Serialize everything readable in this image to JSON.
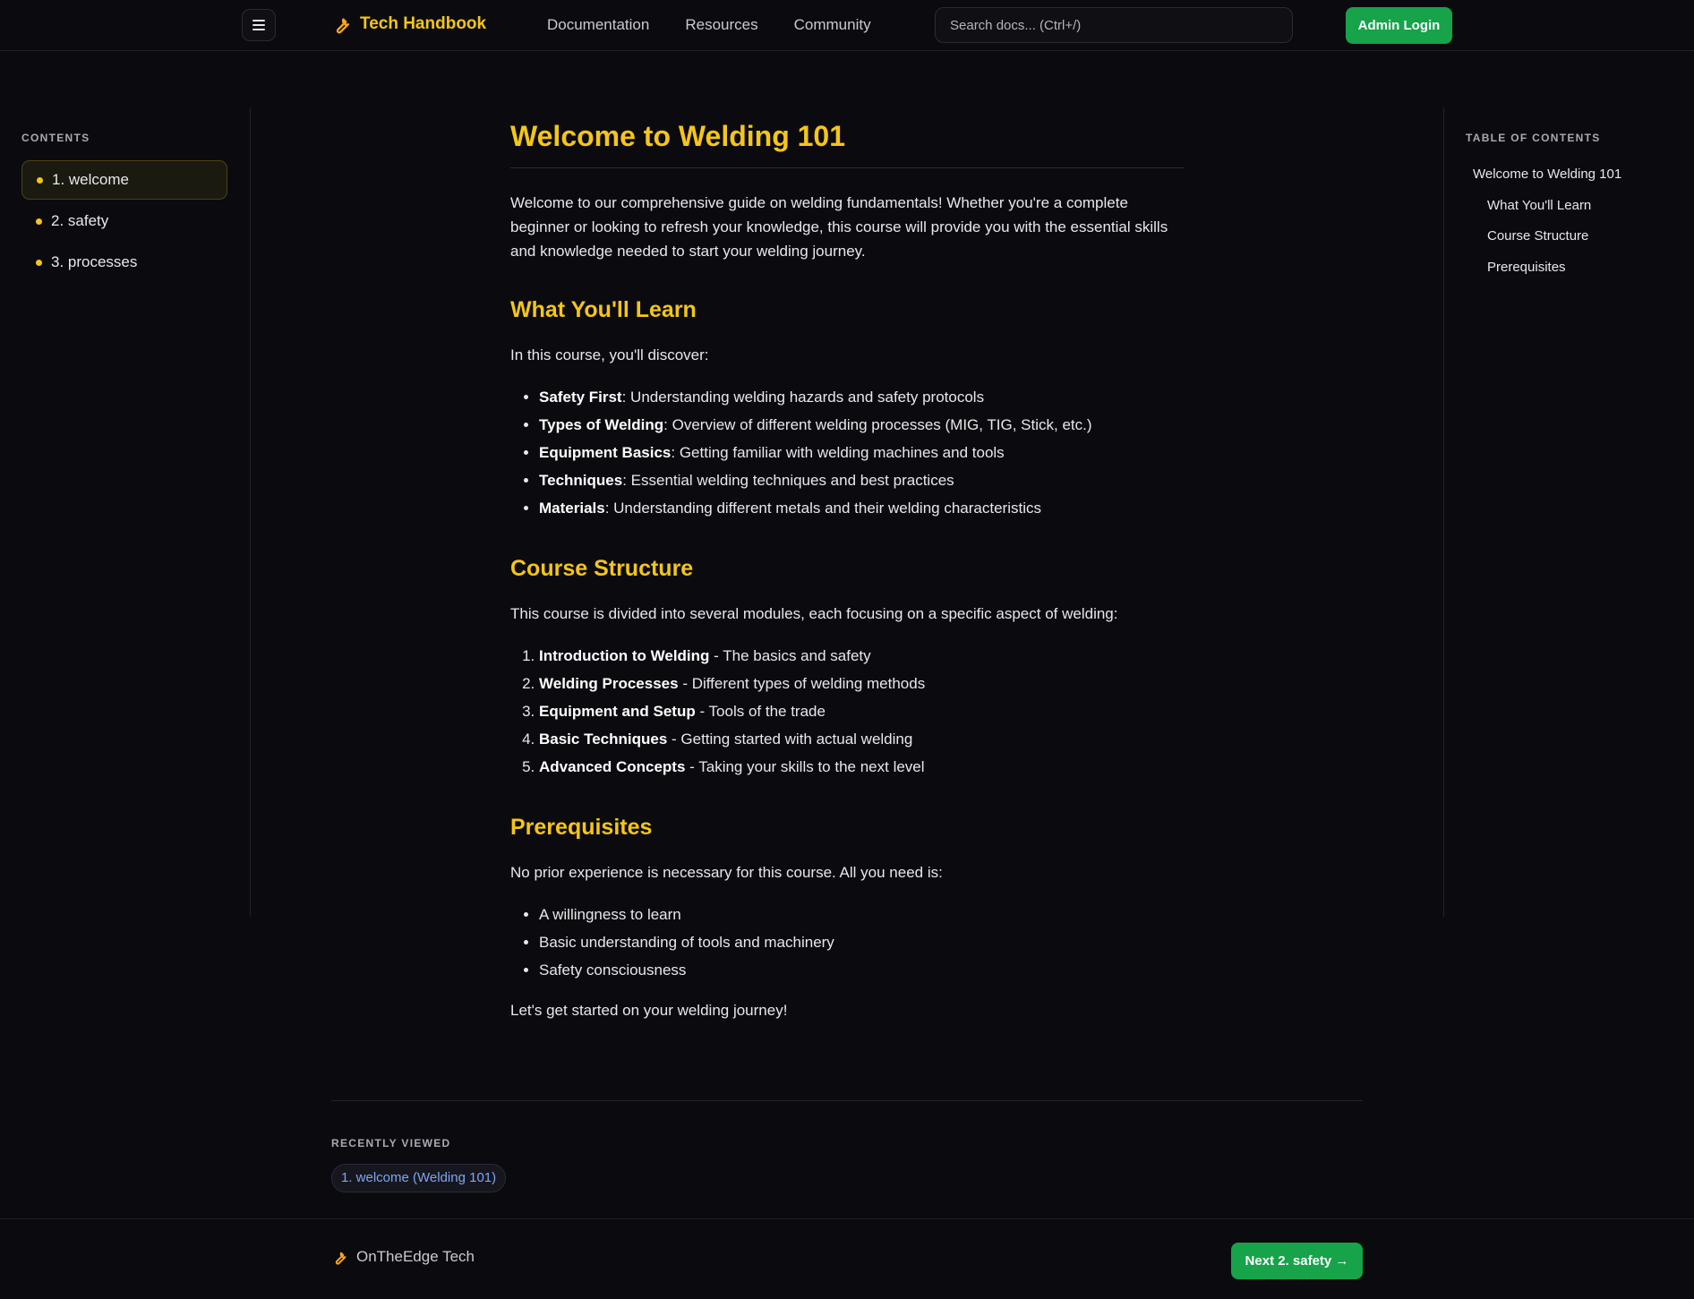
{
  "header": {
    "menu_icon": "hamburger-menu-icon",
    "brand_icon": "wrench-icon",
    "brand": "Tech Handbook",
    "nav": [
      "Documentation",
      "Resources",
      "Community"
    ],
    "search_placeholder": "Search docs... (Ctrl+/)",
    "admin_button": "Admin Login"
  },
  "left_sidebar": {
    "heading": "CONTENTS",
    "items": [
      {
        "label": "1. welcome",
        "active": true
      },
      {
        "label": "2. safety",
        "active": false
      },
      {
        "label": "3. processes",
        "active": false
      }
    ]
  },
  "right_sidebar": {
    "heading": "TABLE OF CONTENTS",
    "items": [
      {
        "label": "Welcome to Welding 101",
        "level": 1
      },
      {
        "label": "What You'll Learn",
        "level": 2
      },
      {
        "label": "Course Structure",
        "level": 2
      },
      {
        "label": "Prerequisites",
        "level": 2
      }
    ]
  },
  "article": {
    "title": "Welcome to Welding 101",
    "intro": "Welcome to our comprehensive guide on welding fundamentals! Whether you're a complete beginner or looking to refresh your knowledge, this course will provide you with the essential skills and knowledge needed to start your welding journey.",
    "learn": {
      "heading": "What You'll Learn",
      "lead": "In this course, you'll discover:",
      "items": [
        {
          "term": "Safety First",
          "sep": ": ",
          "desc": "Understanding welding hazards and safety protocols"
        },
        {
          "term": "Types of Welding",
          "sep": ": ",
          "desc": "Overview of different welding processes (MIG, TIG, Stick, etc.)"
        },
        {
          "term": "Equipment Basics",
          "sep": ": ",
          "desc": "Getting familiar with welding machines and tools"
        },
        {
          "term": "Techniques",
          "sep": ": ",
          "desc": "Essential welding techniques and best practices"
        },
        {
          "term": "Materials",
          "sep": ": ",
          "desc": "Understanding different metals and their welding characteristics"
        }
      ]
    },
    "structure": {
      "heading": "Course Structure",
      "lead": "This course is divided into several modules, each focusing on a specific aspect of welding:",
      "items": [
        {
          "term": "Introduction to Welding",
          "sep": " - ",
          "desc": "The basics and safety"
        },
        {
          "term": "Welding Processes",
          "sep": " - ",
          "desc": "Different types of welding methods"
        },
        {
          "term": "Equipment and Setup",
          "sep": " - ",
          "desc": "Tools of the trade"
        },
        {
          "term": "Basic Techniques",
          "sep": " - ",
          "desc": "Getting started with actual welding"
        },
        {
          "term": "Advanced Concepts",
          "sep": " - ",
          "desc": "Taking your skills to the next level"
        }
      ]
    },
    "prereq": {
      "heading": "Prerequisites",
      "lead": "No prior experience is necessary for this course. All you need is:",
      "items": [
        "A willingness to learn",
        "Basic understanding of tools and machinery",
        "Safety consciousness"
      ]
    },
    "outro": "Let's get started on your welding journey!"
  },
  "recent": {
    "heading": "RECENTLY VIEWED",
    "items": [
      "1. welcome (Welding 101)"
    ]
  },
  "footer": {
    "brand_icon": "wrench-icon",
    "brand": "OnTheEdge Tech",
    "next_button": "Next 2. safety →"
  },
  "colors": {
    "accent": "#f5c518",
    "button": "#16a34a",
    "background": "#0b0b0f",
    "link": "#7ea6f0"
  }
}
